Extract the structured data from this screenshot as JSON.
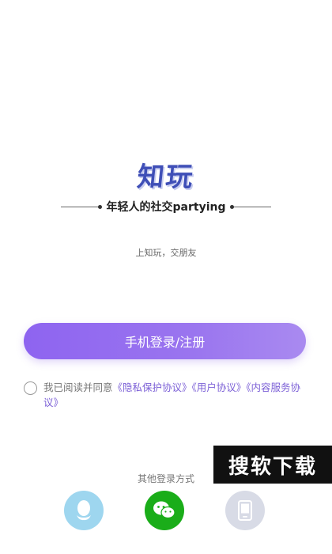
{
  "brand": {
    "logo_text": "知玩",
    "tagline": "年轻人的社交partying",
    "slogan": "上知玩，交朋友"
  },
  "login": {
    "phone_button_label": "手机登录/注册"
  },
  "agreement": {
    "prefix": "我已阅读并同意",
    "privacy_link": "《隐私保护协议》",
    "user_link": "《用户协议》",
    "content_link": "《内容服务协议》"
  },
  "other_login": {
    "label": "其他登录方式",
    "icons": [
      "qq-icon",
      "wechat-icon",
      "phone-icon"
    ]
  },
  "watermark": {
    "text": "搜软下载"
  },
  "colors": {
    "accent": "#8e64f0",
    "link": "#7b5fd6",
    "wechat": "#1aad19",
    "qq": "#9ed6ef",
    "device": "#d8dbe6"
  }
}
